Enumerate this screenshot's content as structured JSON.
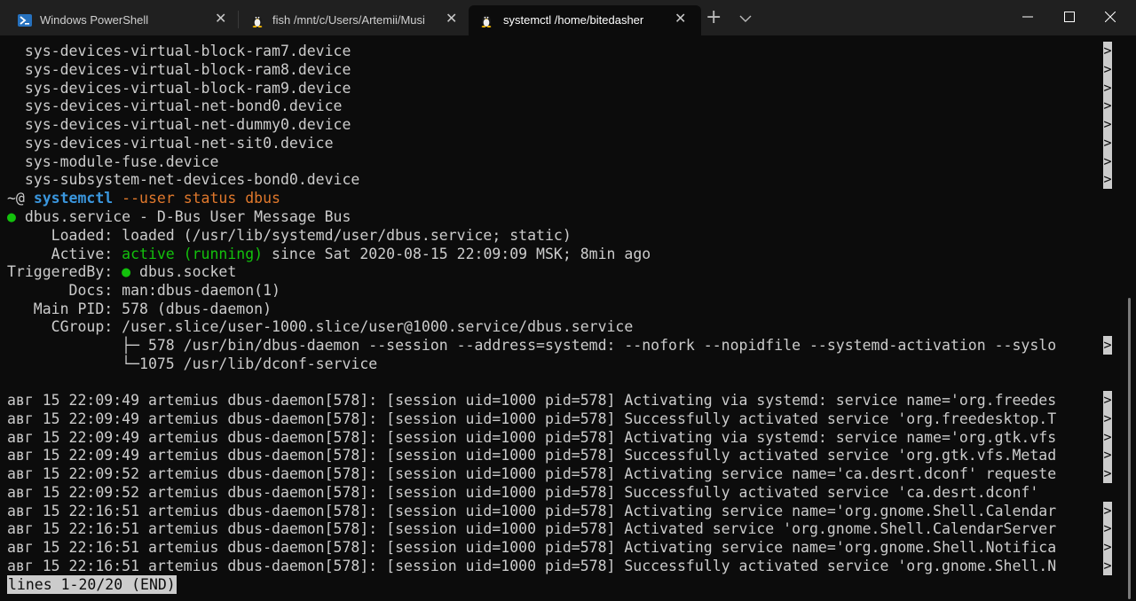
{
  "tabs": [
    {
      "title": "Windows PowerShell",
      "icon": "powershell-icon"
    },
    {
      "title": "fish /mnt/c/Users/Artemii/Musi",
      "icon": "linux-penguin-icon"
    },
    {
      "title": "systemctl /home/bitedasher",
      "icon": "linux-penguin-icon",
      "active": true
    }
  ],
  "tab_controls": {
    "new_tab": "+",
    "dropdown": "⌄"
  },
  "colors": {
    "green": "#13c10c",
    "cyan": "#3a96dd",
    "orange": "#e0782c",
    "fg": "#cccccc",
    "bg": "#0c0c0c"
  },
  "terminal": {
    "device_lines": [
      "  sys-devices-virtual-block-ram7.device",
      "  sys-devices-virtual-block-ram8.device",
      "  sys-devices-virtual-block-ram9.device",
      "  sys-devices-virtual-net-bond0.device",
      "  sys-devices-virtual-net-dummy0.device",
      "  sys-devices-virtual-net-sit0.device",
      "  sys-module-fuse.device",
      "  sys-subsystem-net-devices-bond0.device"
    ],
    "prompt": {
      "prefix": "~@ ",
      "command": "systemctl",
      "args": " --user status dbus"
    },
    "service": {
      "bullet": "●",
      "header": " dbus.service - D-Bus User Message Bus",
      "loaded_label": "     Loaded: ",
      "loaded_value": "loaded (/usr/lib/systemd/user/dbus.service; static)",
      "active_label": "     Active: ",
      "active_state": "active (running)",
      "active_rest": " since Sat 2020-08-15 22:09:09 MSK; 8min ago",
      "triggered_label": "TriggeredBy: ",
      "triggered_bullet": "●",
      "triggered_value": " dbus.socket",
      "docs_line": "       Docs: man:dbus-daemon(1)",
      "pid_line": "   Main PID: 578 (dbus-daemon)",
      "cgroup_line": "     CGroup: /user.slice/user-1000.slice/user@1000.service/dbus.service",
      "cgroup_child1": "             ├─ 578 /usr/bin/dbus-daemon --session --address=systemd: --nofork --nopidfile --systemd-activation --syslo",
      "cgroup_child2": "             └─1075 /usr/lib/dconf-service"
    },
    "log_lines": [
      "авг 15 22:09:49 artemius dbus-daemon[578]: [session uid=1000 pid=578] Activating via systemd: service name='org.freedes",
      "авг 15 22:09:49 artemius dbus-daemon[578]: [session uid=1000 pid=578] Successfully activated service 'org.freedesktop.T",
      "авг 15 22:09:49 artemius dbus-daemon[578]: [session uid=1000 pid=578] Activating via systemd: service name='org.gtk.vfs",
      "авг 15 22:09:49 artemius dbus-daemon[578]: [session uid=1000 pid=578] Successfully activated service 'org.gtk.vfs.Metad",
      "авг 15 22:09:52 artemius dbus-daemon[578]: [session uid=1000 pid=578] Activating service name='ca.desrt.dconf' requeste",
      "авг 15 22:09:52 artemius dbus-daemon[578]: [session uid=1000 pid=578] Successfully activated service 'ca.desrt.dconf'",
      "авг 15 22:16:51 artemius dbus-daemon[578]: [session uid=1000 pid=578] Activating service name='org.gnome.Shell.Calendar",
      "авг 15 22:16:51 artemius dbus-daemon[578]: [session uid=1000 pid=578] Activated service 'org.gnome.Shell.CalendarServer",
      "авг 15 22:16:51 artemius dbus-daemon[578]: [session uid=1000 pid=578] Activating service name='org.gnome.Shell.Notifica",
      "авг 15 22:16:51 artemius dbus-daemon[578]: [session uid=1000 pid=578] Successfully activated service 'org.gnome.Shell.N"
    ],
    "truncation_marker": ">",
    "status": "lines 1-20/20 (END)"
  }
}
